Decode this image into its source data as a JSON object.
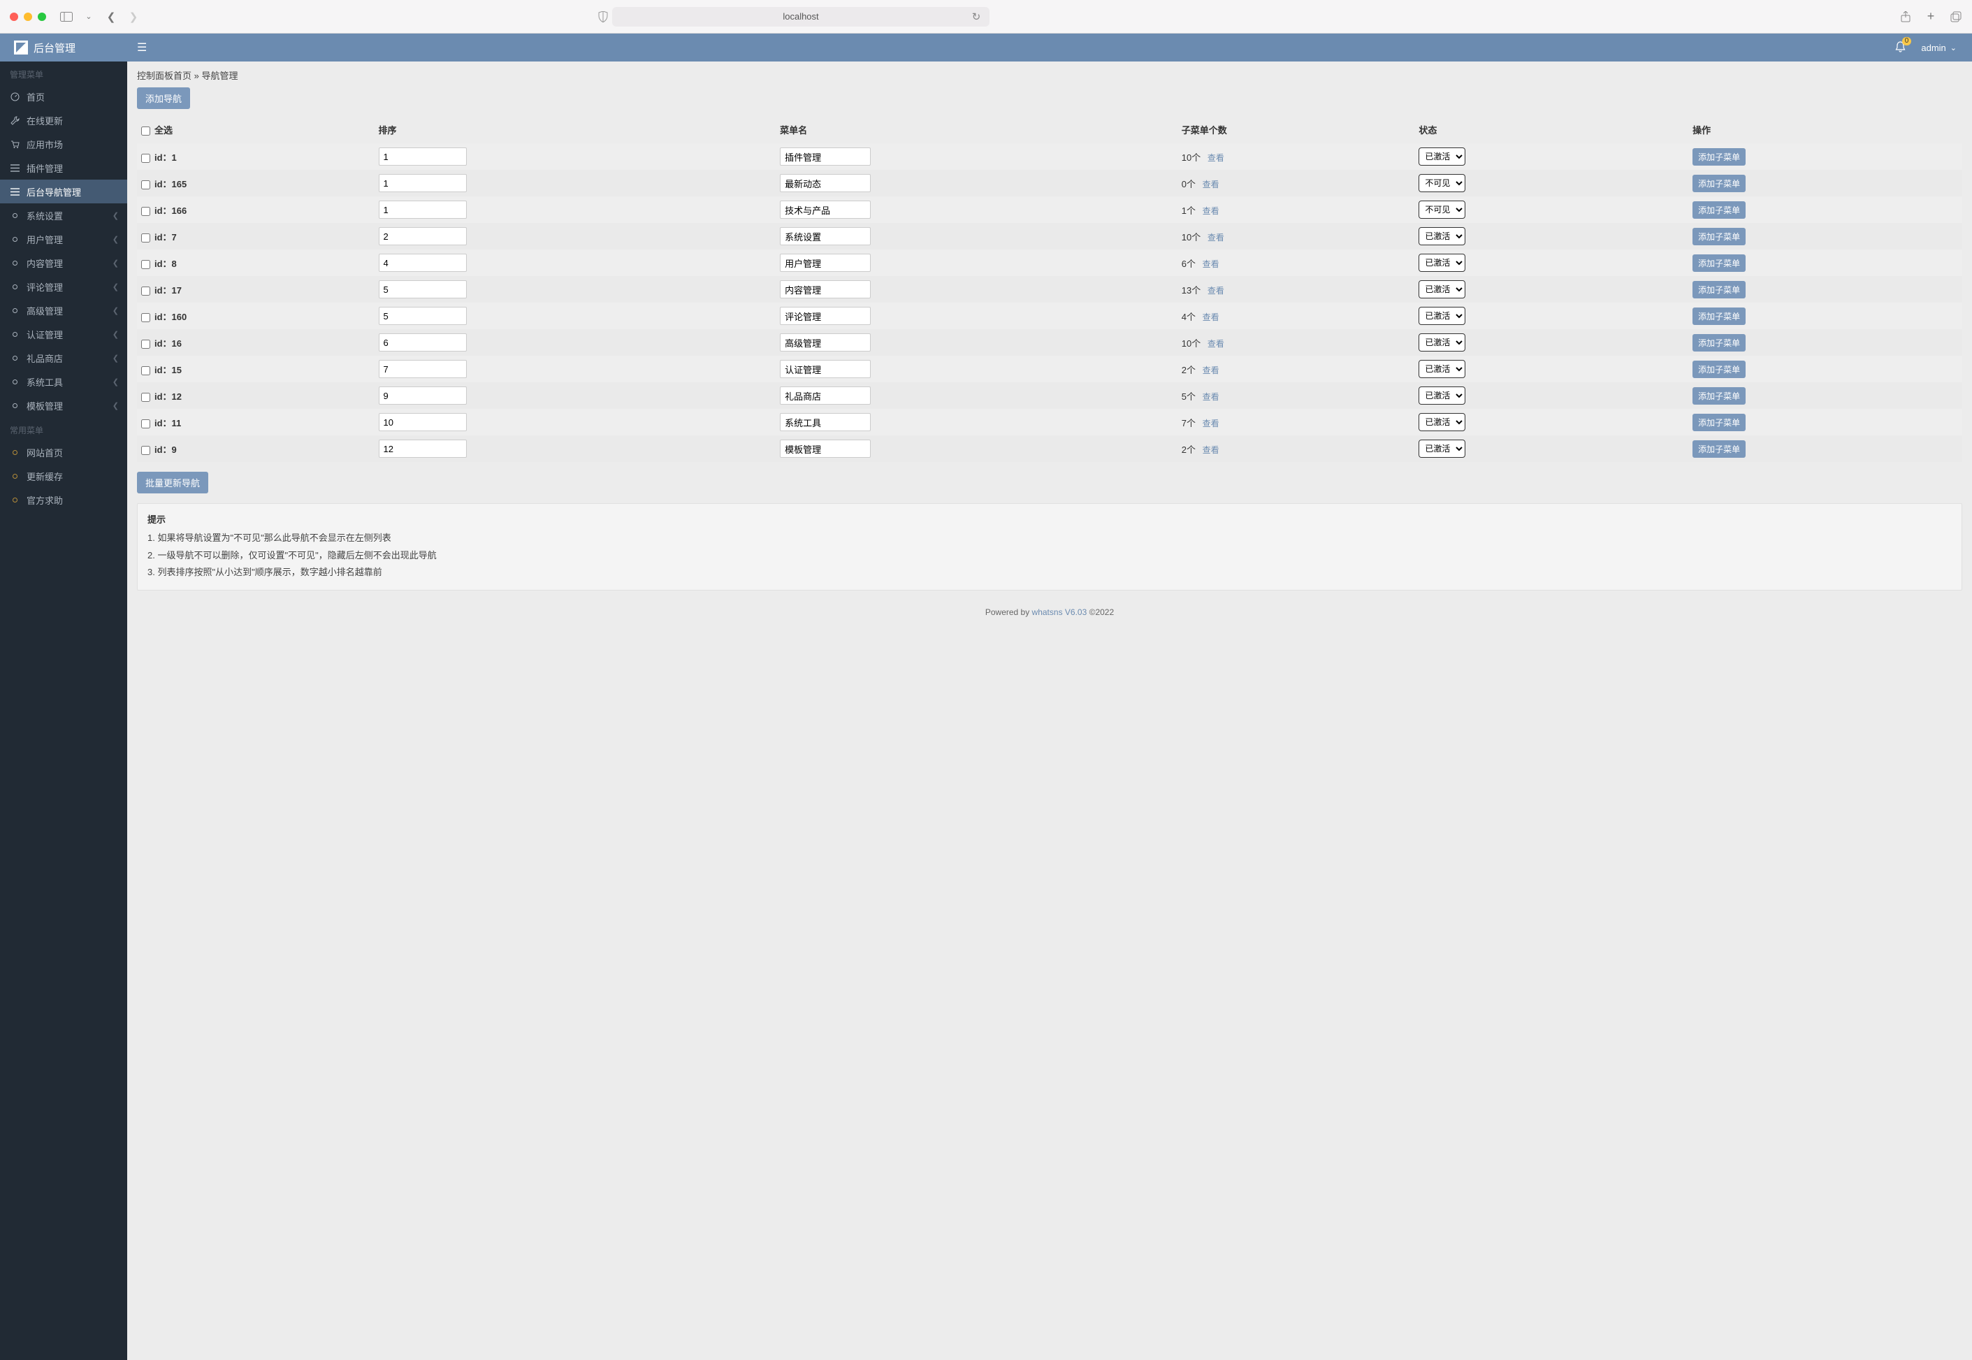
{
  "browser": {
    "url": "localhost"
  },
  "header": {
    "logo_text": "后台管理",
    "notif_count": "0",
    "username": "admin"
  },
  "sidebar": {
    "heading_manage": "管理菜单",
    "heading_common": "常用菜单",
    "items_top": [
      {
        "label": "首页",
        "icon": "dashboard"
      },
      {
        "label": "在线更新",
        "icon": "wrench"
      },
      {
        "label": "应用市场",
        "icon": "cart"
      },
      {
        "label": "插件管理",
        "icon": "list"
      },
      {
        "label": "后台导航管理",
        "icon": "list",
        "active": true
      }
    ],
    "items_exp": [
      {
        "label": "系统设置"
      },
      {
        "label": "用户管理"
      },
      {
        "label": "内容管理"
      },
      {
        "label": "评论管理"
      },
      {
        "label": "高级管理"
      },
      {
        "label": "认证管理"
      },
      {
        "label": "礼品商店"
      },
      {
        "label": "系统工具"
      },
      {
        "label": "模板管理"
      }
    ],
    "items_common": [
      {
        "label": "网站首页"
      },
      {
        "label": "更新缓存"
      },
      {
        "label": "官方求助"
      }
    ]
  },
  "breadcrumb": {
    "home": "控制面板首页",
    "sep": " » ",
    "current": "导航管理"
  },
  "buttons": {
    "add_nav": "添加导航",
    "batch_update": "批量更新导航",
    "add_sub": "添加子菜单",
    "view": "查看"
  },
  "table": {
    "headers": {
      "select_all": "全选",
      "sort": "排序",
      "name": "菜单名",
      "sub_count": "子菜单个数",
      "status": "状态",
      "ops": "操作"
    },
    "status_options": {
      "active": "已激活",
      "hidden": "不可见"
    },
    "rows": [
      {
        "id": "1",
        "sort": "1",
        "name": "插件管理",
        "count": "10个",
        "status": "已激活"
      },
      {
        "id": "165",
        "sort": "1",
        "name": "最新动态",
        "count": "0个",
        "status": "不可见"
      },
      {
        "id": "166",
        "sort": "1",
        "name": "技术与产品",
        "count": "1个",
        "status": "不可见"
      },
      {
        "id": "7",
        "sort": "2",
        "name": "系统设置",
        "count": "10个",
        "status": "已激活"
      },
      {
        "id": "8",
        "sort": "4",
        "name": "用户管理",
        "count": "6个",
        "status": "已激活"
      },
      {
        "id": "17",
        "sort": "5",
        "name": "内容管理",
        "count": "13个",
        "status": "已激活"
      },
      {
        "id": "160",
        "sort": "5",
        "name": "评论管理",
        "count": "4个",
        "status": "已激活"
      },
      {
        "id": "16",
        "sort": "6",
        "name": "高级管理",
        "count": "10个",
        "status": "已激活"
      },
      {
        "id": "15",
        "sort": "7",
        "name": "认证管理",
        "count": "2个",
        "status": "已激活"
      },
      {
        "id": "12",
        "sort": "9",
        "name": "礼品商店",
        "count": "5个",
        "status": "已激活"
      },
      {
        "id": "11",
        "sort": "10",
        "name": "系统工具",
        "count": "7个",
        "status": "已激活"
      },
      {
        "id": "9",
        "sort": "12",
        "name": "模板管理",
        "count": "2个",
        "status": "已激活"
      }
    ]
  },
  "tips": {
    "title": "提示",
    "items": [
      "如果将导航设置为\"不可见\"那么此导航不会显示在左侧列表",
      "一级导航不可以删除，仅可设置\"不可见\"，隐藏后左侧不会出现此导航",
      "列表排序按照\"从小达到\"顺序展示，数字越小排名越靠前"
    ]
  },
  "footer": {
    "powered": "Powered by ",
    "product": "whatsns V6.03",
    "copyright": "  ©2022"
  }
}
